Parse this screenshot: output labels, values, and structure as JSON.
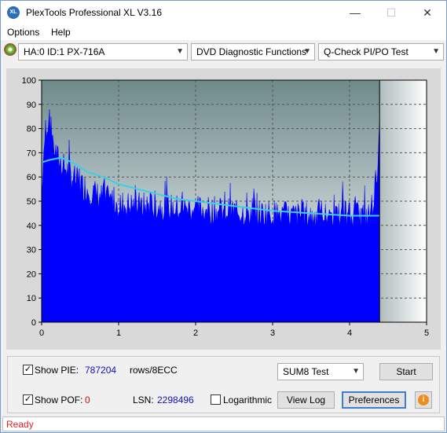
{
  "window": {
    "title": "PlexTools Professional XL V3.16",
    "icon_label": "XL"
  },
  "menu": {
    "options": "Options",
    "help": "Help"
  },
  "toolbar": {
    "drive": "HA:0 ID:1  PX-716A",
    "function": "DVD Diagnostic Functions",
    "test": "Q-Check PI/PO Test"
  },
  "chart_data": {
    "type": "area",
    "title": "",
    "xlabel": "",
    "ylabel": "",
    "xlim": [
      0,
      5
    ],
    "ylim": [
      0,
      100
    ],
    "x_ticks": [
      "0",
      "1",
      "2",
      "3",
      "4",
      "5"
    ],
    "y_ticks": [
      "0",
      "10",
      "20",
      "30",
      "40",
      "50",
      "60",
      "70",
      "80",
      "90",
      "100"
    ],
    "grid": true,
    "data_end_x": 4.39,
    "series": [
      {
        "role": "pie-bars",
        "color": "#0000ff",
        "x": [
          0,
          0.05,
          0.1,
          0.15,
          0.2,
          0.3,
          0.4,
          0.5,
          0.75,
          1.0,
          1.25,
          1.5,
          1.75,
          2.0,
          2.25,
          2.5,
          2.75,
          3.0,
          3.25,
          3.5,
          3.75,
          4.0,
          4.25,
          4.3,
          4.35,
          4.39
        ],
        "values": [
          62,
          86,
          90,
          80,
          74,
          70,
          66,
          63,
          58,
          55,
          54,
          54,
          53,
          53,
          52,
          52,
          51,
          51,
          50,
          50,
          50,
          50,
          50,
          55,
          66,
          83
        ]
      },
      {
        "role": "sum8-line",
        "color": "#3cd0e6",
        "x": [
          0,
          0.1,
          0.25,
          0.4,
          0.6,
          0.8,
          1.0,
          1.25,
          1.5,
          1.75,
          2.0,
          2.5,
          3.0,
          3.5,
          4.0,
          4.39
        ],
        "values": [
          66,
          67,
          68,
          66,
          62,
          60,
          57,
          55,
          53,
          51,
          50,
          48,
          46,
          45,
          44,
          44
        ]
      }
    ]
  },
  "controls": {
    "show_pie_label": "Show PIE:",
    "pie_value": "787204",
    "rows_label": "rows/8ECC",
    "show_pof_label": "Show POF:",
    "pof_value": "0",
    "lsn_label": "LSN:",
    "lsn_value": "2298496",
    "logarithmic_label": "Logarithmic",
    "sum_mode": "SUM8 Test",
    "start": "Start",
    "view_log": "View Log",
    "preferences": "Preferences"
  },
  "status": {
    "text": "Ready"
  }
}
